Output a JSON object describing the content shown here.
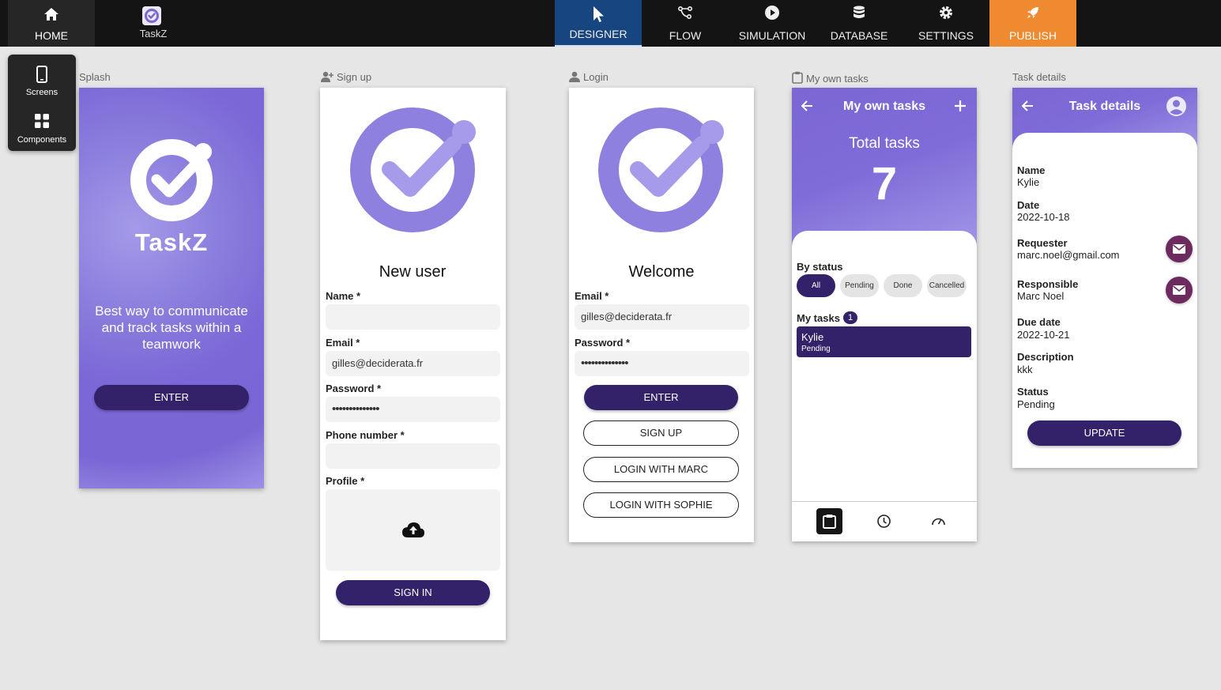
{
  "topbar": {
    "home_label": "HOME",
    "app_name": "TaskZ",
    "tabs": [
      {
        "label": "DESIGNER",
        "icon": "cursor-icon",
        "active": true
      },
      {
        "label": "FLOW",
        "icon": "flow-icon"
      },
      {
        "label": "SIMULATION",
        "icon": "play-icon"
      },
      {
        "label": "DATABASE",
        "icon": "database-icon"
      },
      {
        "label": "SETTINGS",
        "icon": "gear-icon"
      },
      {
        "label": "PUBLISH",
        "icon": "rocket-icon"
      }
    ]
  },
  "side_panel": {
    "items": [
      {
        "label": "Screens",
        "icon": "phone-icon"
      },
      {
        "label": "Components",
        "icon": "grid-icon"
      }
    ]
  },
  "colors": {
    "accent_dark": "#33216a",
    "brand_purple": "#7b66d4",
    "designer_tab": "#17457f",
    "publish_tab": "#ef8a30",
    "mail_button": "#6c2a5e"
  },
  "screens": {
    "splash": {
      "label": "Splash",
      "brand": "TaskZ",
      "tagline": "Best way to communicate and track tasks within a teamwork",
      "enter_button": "ENTER"
    },
    "signup": {
      "label": "Sign up",
      "title": "New user",
      "name_label": "Name *",
      "name_value": "",
      "email_label": "Email *",
      "email_value": "gilles@deciderata.fr",
      "password_label": "Password *",
      "password_value": "••••••••••••••",
      "phone_label": "Phone number *",
      "phone_value": "",
      "profile_label": "Profile *",
      "sign_in_button": "SIGN IN"
    },
    "login": {
      "label": "Login",
      "title": "Welcome",
      "email_label": "Email *",
      "email_value": "gilles@deciderata.fr",
      "password_label": "Password *",
      "password_value": "••••••••••••••",
      "enter_button": "ENTER",
      "signup_button": "SIGN UP",
      "login_marc_button": "LOGIN WITH MARC",
      "login_sophie_button": "LOGIN WITH SOPHIE"
    },
    "my_tasks": {
      "label": "My own tasks",
      "title": "My own tasks",
      "total_label": "Total tasks",
      "total_value": "7",
      "by_status_label": "By status",
      "status_filters": [
        "All",
        "Pending",
        "Done",
        "Cancelled"
      ],
      "my_tasks_label": "My tasks",
      "my_tasks_count": "1",
      "task": {
        "name": "Kylie",
        "status": "Pending"
      }
    },
    "task_details": {
      "label": "Task details",
      "title": "Task details",
      "name_label": "Name",
      "name_value": "Kylie",
      "date_label": "Date",
      "date_value": "2022-10-18",
      "requester_label": "Requester",
      "requester_value": "marc.noel@gmail.com",
      "responsible_label": "Responsible",
      "responsible_value": "Marc Noel",
      "due_label": "Due date",
      "due_value": "2022-10-21",
      "description_label": "Description",
      "description_value": "kkk",
      "status_label": "Status",
      "status_value": "Pending",
      "update_button": "UPDATE"
    }
  }
}
